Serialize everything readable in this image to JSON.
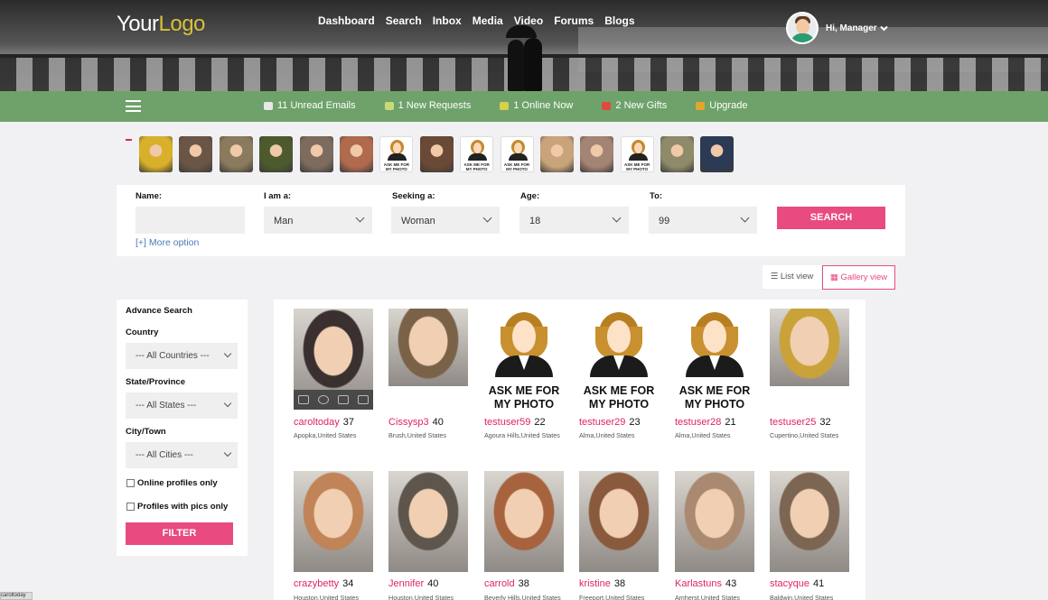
{
  "header": {
    "logo_part1": "Your",
    "logo_part2": "Logo",
    "nav": [
      "Dashboard",
      "Search",
      "Inbox",
      "Media",
      "Video",
      "Forums",
      "Blogs"
    ],
    "greeting": "Hi, Manager"
  },
  "greenbar": {
    "items": [
      {
        "label": "11 Unread Emails",
        "icon": "envelope-icon",
        "color": "#e8e8e8"
      },
      {
        "label": "1 New Requests",
        "icon": "request-icon",
        "color": "#c9d97a"
      },
      {
        "label": "1 Online Now",
        "icon": "person-online-icon",
        "color": "#d6d04a"
      },
      {
        "label": "2 New Gifts",
        "icon": "gift-icon",
        "color": "#e04a3a"
      },
      {
        "label": "Upgrade",
        "icon": "upgrade-icon",
        "color": "#e3a62a"
      }
    ]
  },
  "strip": [
    {
      "type": "photo",
      "color": "#d8b02a"
    },
    {
      "type": "photo",
      "color": "#6b5546"
    },
    {
      "type": "photo",
      "color": "#8a7a5e"
    },
    {
      "type": "photo",
      "color": "#4d5a2e"
    },
    {
      "type": "photo",
      "color": "#7d6b5d"
    },
    {
      "type": "photo",
      "color": "#b06a4e"
    },
    {
      "type": "ask",
      "label": "ASK ME FOR MY PHOTO"
    },
    {
      "type": "photo",
      "color": "#6a4a36"
    },
    {
      "type": "ask",
      "label": "ASK ME FOR MY PHOTO"
    },
    {
      "type": "ask",
      "label": "ASK ME FOR MY PHOTO"
    },
    {
      "type": "photo",
      "color": "#c9a37a"
    },
    {
      "type": "photo",
      "color": "#a48474"
    },
    {
      "type": "ask",
      "label": "ASK ME FOR MY PHOTO"
    },
    {
      "type": "photo",
      "color": "#8e8a6a"
    },
    {
      "type": "photo",
      "color": "#2b3a55"
    }
  ],
  "search": {
    "name_label": "Name:",
    "iam_label": "I am a:",
    "iam_value": "Man",
    "seeking_label": "Seeking a:",
    "seeking_value": "Woman",
    "age_label": "Age:",
    "age_value": "18",
    "to_label": "To:",
    "to_value": "99",
    "search_button": "SEARCH",
    "more_option": "[+]  More option"
  },
  "views": {
    "list": "List view",
    "gallery": "Gallery view"
  },
  "advance": {
    "title": "Advance Search",
    "country_label": "Country",
    "country_value": "--- All Countries ---",
    "state_label": "State/Province",
    "state_value": "--- All States ---",
    "city_label": "City/Town",
    "city_value": "--- All Cities ---",
    "online_only": "Online profiles only",
    "with_pics": "Profiles with pics only",
    "filter_button": "FILTER"
  },
  "profiles": [
    {
      "name": "caroltoday",
      "age": "37",
      "location": "Apopka,United States",
      "photo": "photo",
      "color": "#3a3030"
    },
    {
      "name": "Cissysp3",
      "age": "40",
      "location": "Brush,United States",
      "photo": "photo",
      "color": "#7a6248"
    },
    {
      "name": "testuser59",
      "age": "22",
      "location": "Agoura Hills,United States",
      "photo": "ask",
      "label": "ASK ME FOR MY PHOTO"
    },
    {
      "name": "testuser29",
      "age": "23",
      "location": "Alma,United States",
      "photo": "ask",
      "label": "ASK ME FOR MY PHOTO"
    },
    {
      "name": "testuser28",
      "age": "21",
      "location": "Alma,United States",
      "photo": "ask",
      "label": "ASK ME FOR MY PHOTO"
    },
    {
      "name": "testuser25",
      "age": "32",
      "location": "Cupertino,United States",
      "photo": "photo",
      "color": "#c9a23a"
    },
    {
      "name": "crazybetty",
      "age": "34",
      "location": "Houston,United States",
      "photo": "photo",
      "color": "#c08458"
    },
    {
      "name": "Jennifer",
      "age": "40",
      "location": "Houston,United States",
      "photo": "photo",
      "color": "#5e564c"
    },
    {
      "name": "carrold",
      "age": "38",
      "location": "Beverly Hills,United States",
      "photo": "photo",
      "color": "#a7633e"
    },
    {
      "name": "kristine",
      "age": "38",
      "location": "Freeport,United States",
      "photo": "photo",
      "color": "#8a5a3e"
    },
    {
      "name": "Karlastuns",
      "age": "43",
      "location": "Amherst,United States",
      "photo": "photo",
      "color": "#a98a70"
    },
    {
      "name": "stacyque",
      "age": "41",
      "location": "Baldwin,United States",
      "photo": "photo",
      "color": "#7c6552"
    }
  ],
  "statusbar": "caroltoday"
}
